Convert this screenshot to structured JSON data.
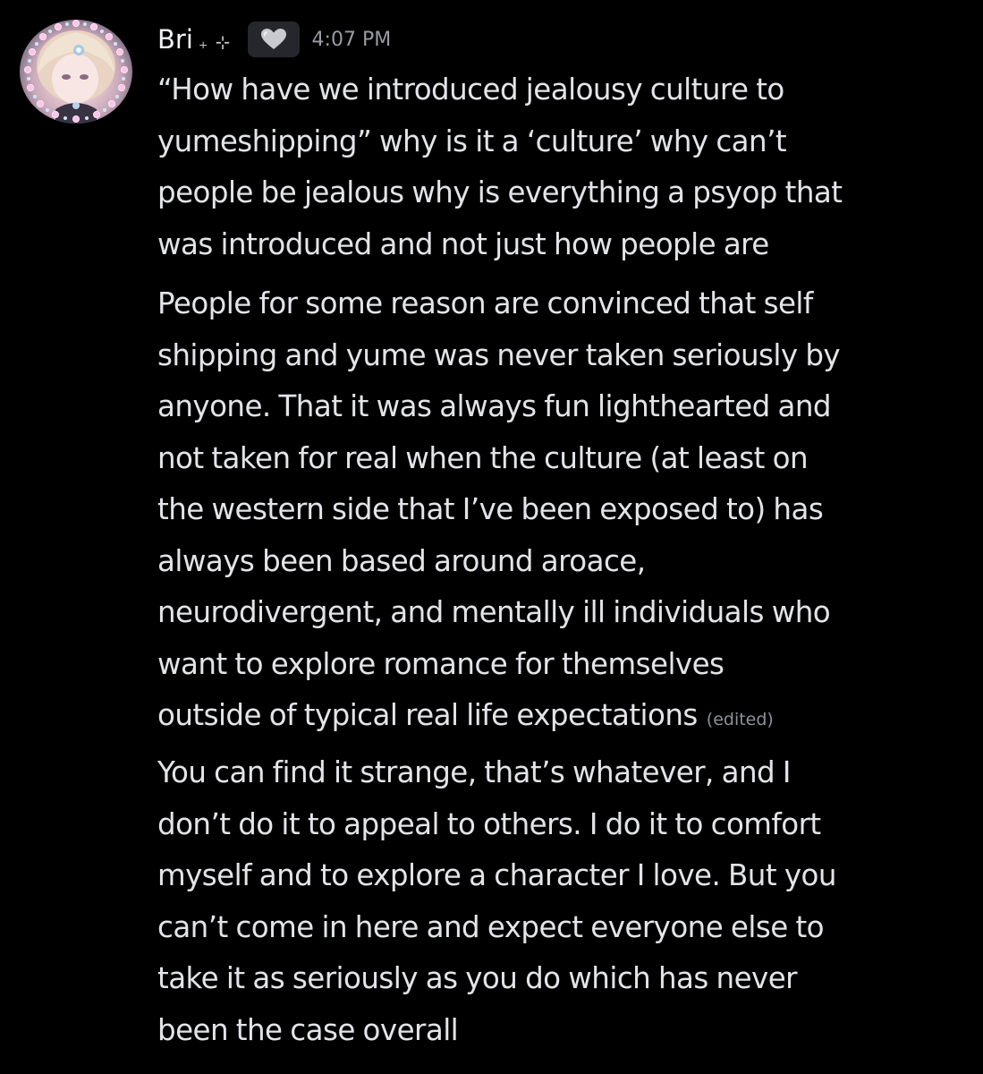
{
  "message": {
    "author": "Bri",
    "author_decoration": "₊ ⊹",
    "badge_icon": "grey-heart-icon",
    "timestamp": "4:07 PM",
    "posts": [
      {
        "text": "“How have we introduced jealousy culture to\nyumeshipping” why is it a ‘culture’ why can’t\npeople be jealous why is everything a psyop that\nwas introduced and not just how people are"
      },
      {
        "text": "People for some reason are convinced that self\nshipping and yume was never taken seriously by\nanyone. That it was always fun lighthearted and\nnot taken for real when the culture (at least on\nthe western side that I’ve been exposed to) has\nalways been based around aroace,\nneurodivergent, and mentally ill individuals who\nwant to explore romance for themselves\noutside of typical real life expectations",
        "edited_label": "(edited)"
      },
      {
        "text": "You can find it strange, that’s whatever, and I\ndon’t do it to appeal to others. I do it to comfort\nmyself and to explore a character I love. But you\ncan’t come in here and expect everyone else to\ntake it as seriously as you do which has never\nbeen the case overall"
      }
    ]
  },
  "colors": {
    "background": "#000000",
    "message_text": "#e3e4e8",
    "username": "#f2f3f5",
    "timestamp": "#9a9ba3",
    "badge_background": "#26272d"
  }
}
